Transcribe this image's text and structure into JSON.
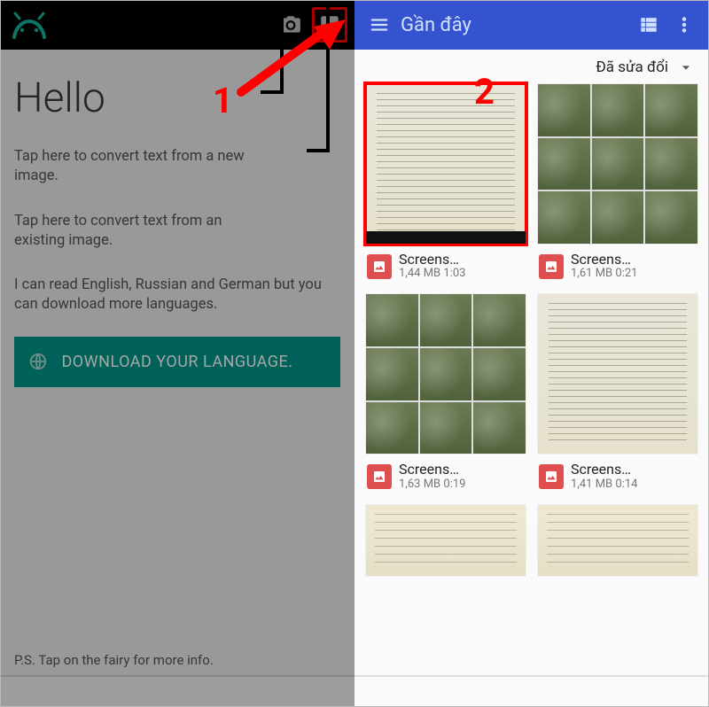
{
  "annotations": {
    "step1": "1",
    "step2": "2"
  },
  "left": {
    "title": "Hello",
    "tip_new_image": "Tap here to convert text from a new image.",
    "tip_existing_image": "Tap here to convert text from an existing image.",
    "languages_note": "I can read English, Russian and German but you can download more languages.",
    "download_button": "DOWNLOAD YOUR LANGUAGE.",
    "postscript": "P.S. Tap on the fairy for more info."
  },
  "right": {
    "header_title": "Gần đây",
    "sort_label": "Đã sửa đổi",
    "files": [
      {
        "name": "Screens…",
        "size": "1,44 MB",
        "time": "1:03",
        "thumb": "page",
        "highlighted": true
      },
      {
        "name": "Screens…",
        "size": "1,61 MB",
        "time": "0:21",
        "thumb": "collage"
      },
      {
        "name": "Screens…",
        "size": "1,63 MB",
        "time": "0:19",
        "thumb": "collage"
      },
      {
        "name": "Screens…",
        "size": "1,41 MB",
        "time": "0:14",
        "thumb": "page"
      }
    ],
    "bottom_thumbs": [
      "paper",
      "paper"
    ]
  },
  "colors": {
    "accent_left": "#009688",
    "accent_right": "#3553cf",
    "annotation": "#ff0000"
  }
}
